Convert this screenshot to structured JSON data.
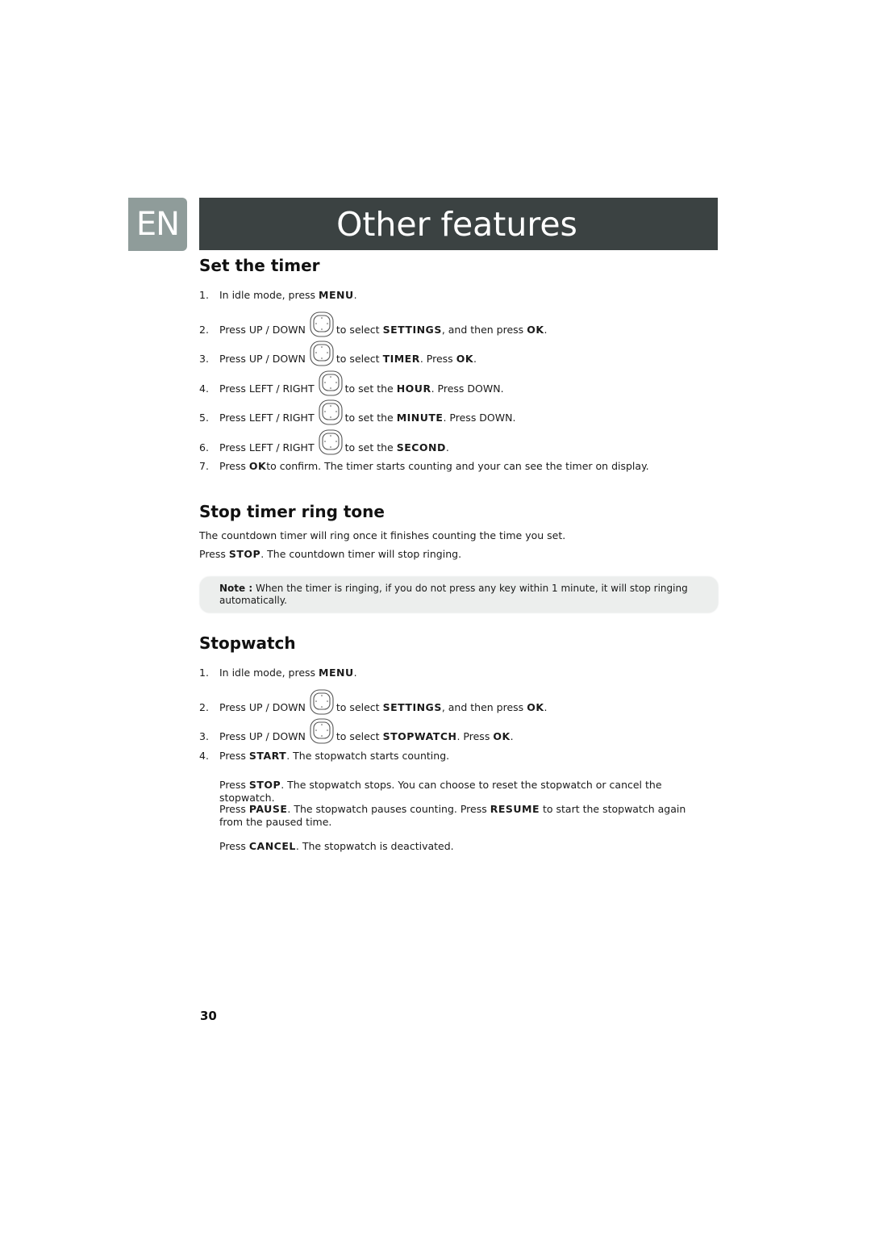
{
  "header": {
    "language_tab": "EN",
    "title": "Other features"
  },
  "icons": {
    "navigation_pad": "navigation-pad-icon"
  },
  "sections": {
    "set_timer": {
      "heading": "Set the timer",
      "steps": [
        {
          "num": "1.",
          "pre": "In idle mode, press ",
          "b1": "MENU",
          "mid": ".",
          "b2": "",
          "post": ""
        },
        {
          "num": "2.",
          "pre": "Press  UP / DOWN",
          "after_icon": "to select ",
          "b1": "SETTINGS",
          "mid": ", and then press ",
          "b2": "OK",
          "post": "."
        },
        {
          "num": "3.",
          "pre": "Press  UP / DOWN",
          "after_icon": "to select ",
          "b1": "TIMER",
          "mid": ". Press ",
          "b2": "OK",
          "post": "."
        },
        {
          "num": "4.",
          "pre": "Press LEFT / RIGHT",
          "after_icon": "to set the ",
          "b1": "HOUR",
          "mid": ". Press DOWN.",
          "b2": "",
          "post": ""
        },
        {
          "num": "5.",
          "pre": "Press LEFT / RIGHT",
          "after_icon": "to set the ",
          "b1": "MINUTE",
          "mid": ". Press DOWN.",
          "b2": "",
          "post": ""
        },
        {
          "num": "6.",
          "pre": "Press LEFT / RIGHT",
          "after_icon": "to set the ",
          "b1": "SECOND",
          "mid": ".",
          "b2": "",
          "post": ""
        },
        {
          "num": "7.",
          "pre": "Press ",
          "b1": "OK",
          "mid": " to confirm. The timer starts counting and your can see the timer on display.",
          "b2": "",
          "post": ""
        }
      ]
    },
    "stop_ring": {
      "heading": "Stop timer ring tone",
      "line1": "The countdown timer will ring once it finishes counting the time you set.",
      "line2_pre": "Press ",
      "line2_bold": "STOP",
      "line2_post": ". The countdown timer will stop ringing.",
      "note_label": "Note :",
      "note_text": " When the timer is ringing, if you do not press any key within 1 minute, it will stop ringing automatically."
    },
    "stopwatch": {
      "heading": "Stopwatch",
      "steps": [
        {
          "num": "1.",
          "pre": "In idle mode, press ",
          "b1": "MENU",
          "mid": ".",
          "b2": "",
          "post": ""
        },
        {
          "num": "2.",
          "pre": "Press  UP / DOWN",
          "after_icon": "to select ",
          "b1": "SETTINGS",
          "mid": ", and then press ",
          "b2": "OK",
          "post": "."
        },
        {
          "num": "3.",
          "pre": "Press  UP / DOWN",
          "after_icon": "to select ",
          "b1": "STOPWATCH",
          "mid": ". Press ",
          "b2": "OK",
          "post": "."
        },
        {
          "num": "4.",
          "pre": "Press ",
          "b1": "START",
          "mid": ". The stopwatch starts counting.",
          "b2": "",
          "post": ""
        }
      ],
      "sub_paragraphs": [
        {
          "pre": "Press ",
          "b1": "STOP",
          "mid": ". The stopwatch stops. You can choose to reset the stopwatch or cancel the stopwatch.",
          "b2": "",
          "post": ""
        },
        {
          "pre": "Press ",
          "b1": "PAUSE",
          "mid": ". The stopwatch pauses counting. Press ",
          "b2": "RESUME",
          "post": " to start the stopwatch again from the paused time."
        },
        {
          "pre": "Press ",
          "b1": "CANCEL",
          "mid": ". The stopwatch is deactivated.",
          "b2": "",
          "post": ""
        }
      ]
    }
  },
  "footer": {
    "page_number": "30"
  }
}
